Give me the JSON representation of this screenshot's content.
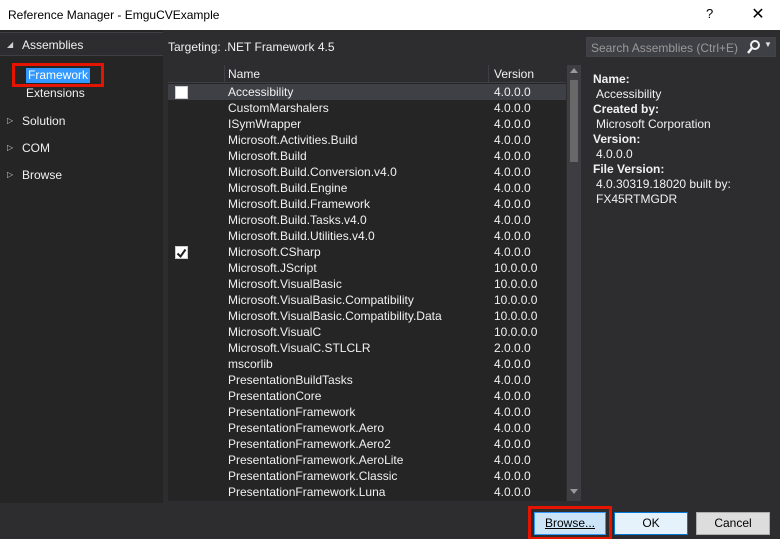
{
  "window": {
    "title": "Reference Manager - EmguCVExample",
    "help_label": "?",
    "close_label": "✕"
  },
  "nav": {
    "assemblies": "Assemblies",
    "framework": "Framework",
    "extensions": "Extensions",
    "solution": "Solution",
    "com": "COM",
    "browse": "Browse"
  },
  "targeting": "Targeting: .NET Framework 4.5",
  "search": {
    "placeholder": "Search Assemblies (Ctrl+E)",
    "icon": "search-icon"
  },
  "list": {
    "headers": {
      "name": "Name",
      "version": "Version"
    },
    "rows": [
      {
        "name": "Accessibility",
        "version": "4.0.0.0",
        "checkbox": "empty",
        "selected": true
      },
      {
        "name": "CustomMarshalers",
        "version": "4.0.0.0",
        "checkbox": "none"
      },
      {
        "name": "ISymWrapper",
        "version": "4.0.0.0",
        "checkbox": "none"
      },
      {
        "name": "Microsoft.Activities.Build",
        "version": "4.0.0.0",
        "checkbox": "none"
      },
      {
        "name": "Microsoft.Build",
        "version": "4.0.0.0",
        "checkbox": "none"
      },
      {
        "name": "Microsoft.Build.Conversion.v4.0",
        "version": "4.0.0.0",
        "checkbox": "none"
      },
      {
        "name": "Microsoft.Build.Engine",
        "version": "4.0.0.0",
        "checkbox": "none"
      },
      {
        "name": "Microsoft.Build.Framework",
        "version": "4.0.0.0",
        "checkbox": "none"
      },
      {
        "name": "Microsoft.Build.Tasks.v4.0",
        "version": "4.0.0.0",
        "checkbox": "none"
      },
      {
        "name": "Microsoft.Build.Utilities.v4.0",
        "version": "4.0.0.0",
        "checkbox": "none"
      },
      {
        "name": "Microsoft.CSharp",
        "version": "4.0.0.0",
        "checkbox": "checked"
      },
      {
        "name": "Microsoft.JScript",
        "version": "10.0.0.0",
        "checkbox": "none"
      },
      {
        "name": "Microsoft.VisualBasic",
        "version": "10.0.0.0",
        "checkbox": "none"
      },
      {
        "name": "Microsoft.VisualBasic.Compatibility",
        "version": "10.0.0.0",
        "checkbox": "none"
      },
      {
        "name": "Microsoft.VisualBasic.Compatibility.Data",
        "version": "10.0.0.0",
        "checkbox": "none"
      },
      {
        "name": "Microsoft.VisualC",
        "version": "10.0.0.0",
        "checkbox": "none"
      },
      {
        "name": "Microsoft.VisualC.STLCLR",
        "version": "2.0.0.0",
        "checkbox": "none"
      },
      {
        "name": "mscorlib",
        "version": "4.0.0.0",
        "checkbox": "none"
      },
      {
        "name": "PresentationBuildTasks",
        "version": "4.0.0.0",
        "checkbox": "none"
      },
      {
        "name": "PresentationCore",
        "version": "4.0.0.0",
        "checkbox": "none"
      },
      {
        "name": "PresentationFramework",
        "version": "4.0.0.0",
        "checkbox": "none"
      },
      {
        "name": "PresentationFramework.Aero",
        "version": "4.0.0.0",
        "checkbox": "none"
      },
      {
        "name": "PresentationFramework.Aero2",
        "version": "4.0.0.0",
        "checkbox": "none"
      },
      {
        "name": "PresentationFramework.AeroLite",
        "version": "4.0.0.0",
        "checkbox": "none"
      },
      {
        "name": "PresentationFramework.Classic",
        "version": "4.0.0.0",
        "checkbox": "none"
      },
      {
        "name": "PresentationFramework.Luna",
        "version": "4.0.0.0",
        "checkbox": "none"
      }
    ]
  },
  "details": {
    "name_label": "Name:",
    "name_value": "Accessibility",
    "created_by_label": "Created by:",
    "created_by_value": "Microsoft Corporation",
    "version_label": "Version:",
    "version_value": "4.0.0.0",
    "file_version_label": "File Version:",
    "file_version_value": "4.0.30319.18020 built by: FX45RTMGDR"
  },
  "buttons": {
    "browse": "Browse...",
    "ok": "OK",
    "cancel": "Cancel"
  },
  "colors": {
    "highlight_outline": "#e51400",
    "selection_blue": "#3399ff",
    "background": "#2d2d30"
  }
}
